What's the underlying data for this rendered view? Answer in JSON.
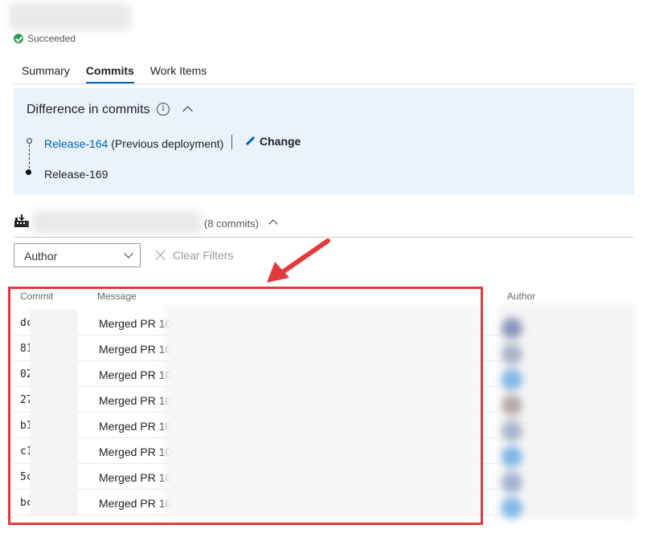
{
  "header": {
    "status": "Succeeded"
  },
  "tabs": [
    {
      "label": "Summary",
      "active": false
    },
    {
      "label": "Commits",
      "active": true
    },
    {
      "label": "Work Items",
      "active": false
    }
  ],
  "diff": {
    "title": "Difference in commits",
    "previous": {
      "release": "Release-164",
      "note": "(Previous deployment)"
    },
    "change_label": "Change",
    "current": {
      "release": "Release-169"
    }
  },
  "pipeline": {
    "count_text": "(8 commits)"
  },
  "filters": {
    "author_label": "Author",
    "clear_label": "Clear Filters"
  },
  "table": {
    "columns": {
      "commit": "Commit",
      "message": "Message",
      "author": "Author"
    },
    "rows": [
      {
        "hash": "dc",
        "message": "Merged PR 10"
      },
      {
        "hash": "81",
        "message": "Merged PR 10"
      },
      {
        "hash": "02",
        "message": "Merged PR 10"
      },
      {
        "hash": "27",
        "message": "Merged PR 10"
      },
      {
        "hash": "b1",
        "message": "Merged PR 10"
      },
      {
        "hash": "c1",
        "message": "Merged PR 10"
      },
      {
        "hash": "5c",
        "message": "Merged PR 10"
      },
      {
        "hash": "bc",
        "message": "Merged PR 10"
      }
    ]
  },
  "colors": {
    "accent": "#0063b1",
    "success": "#2e9e4e",
    "annotation": "#e23b3b",
    "panel": "#eaf2fb"
  }
}
